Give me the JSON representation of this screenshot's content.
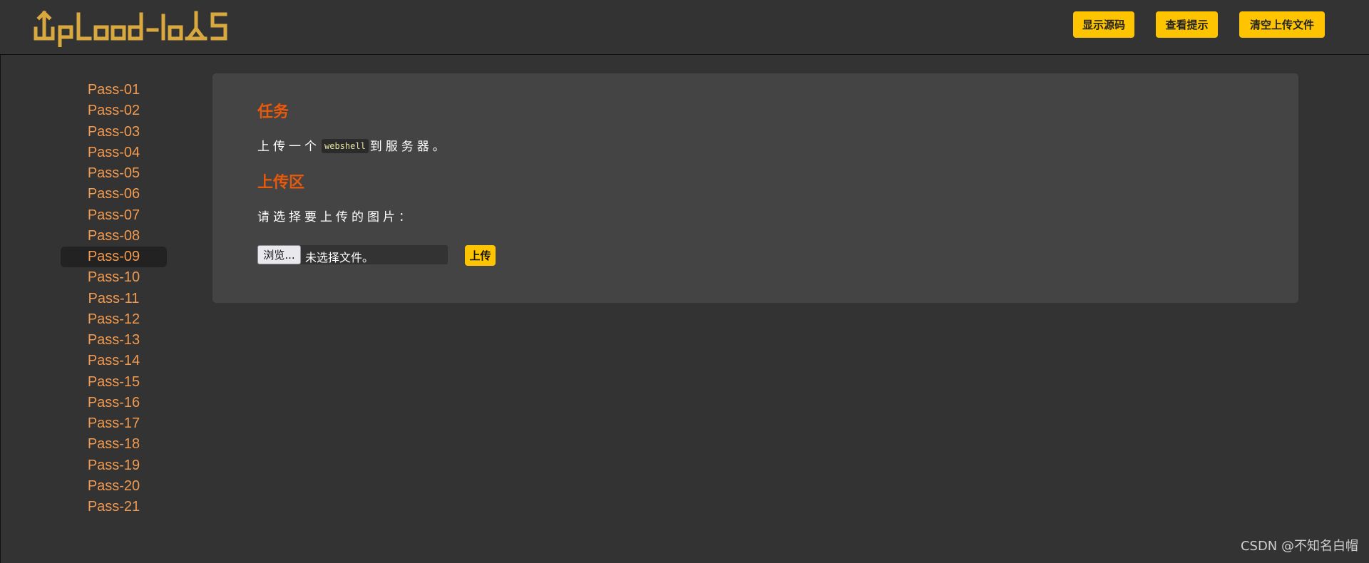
{
  "header": {
    "logo_text": "Upload-labs",
    "buttons": {
      "show_source": "显示源码",
      "view_hint": "查看提示",
      "clear_uploads": "清空上传文件"
    }
  },
  "sidebar": {
    "active": "Pass-09",
    "items": [
      "Pass-01",
      "Pass-02",
      "Pass-03",
      "Pass-04",
      "Pass-05",
      "Pass-06",
      "Pass-07",
      "Pass-08",
      "Pass-09",
      "Pass-10",
      "Pass-11",
      "Pass-12",
      "Pass-13",
      "Pass-14",
      "Pass-15",
      "Pass-16",
      "Pass-17",
      "Pass-18",
      "Pass-19",
      "Pass-20",
      "Pass-21"
    ]
  },
  "main": {
    "task_title": "任务",
    "task_text_before": "上传一个",
    "task_code": "webshell",
    "task_text_after": "到服务器。",
    "upload_title": "上传区",
    "choose_label": "请选择要上传的图片：",
    "file_input": {
      "browse_label": "浏览...",
      "status": "未选择文件。"
    },
    "upload_button": "上传"
  },
  "watermark": "CSDN @不知名白帽",
  "colors": {
    "background": "#333333",
    "panel": "#444444",
    "accent_button": "#ffc400",
    "section_title": "#e8590c",
    "sidebar_link": "#f39b50",
    "logo": "#d9a93f"
  }
}
